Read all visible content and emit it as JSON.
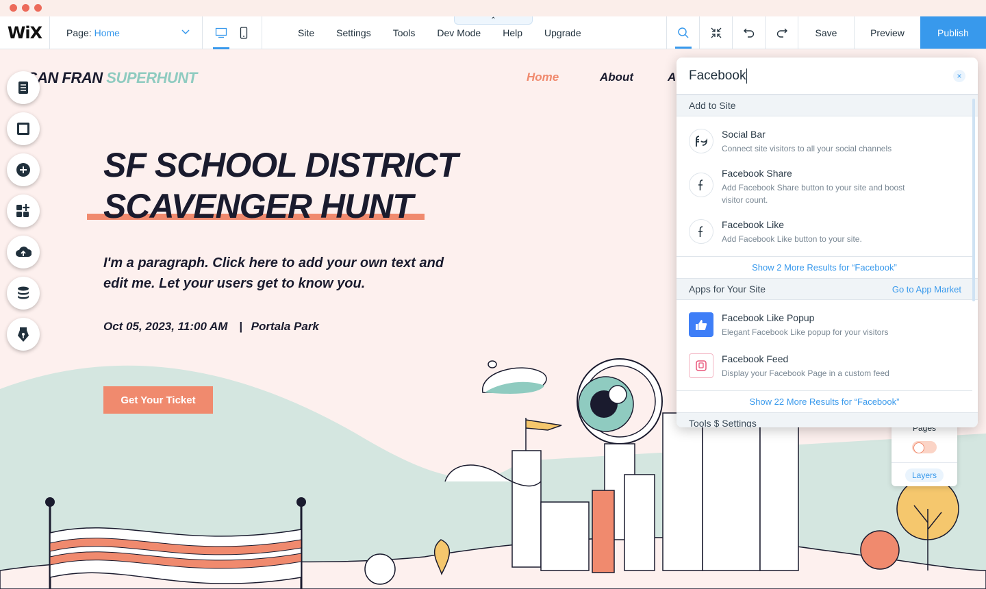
{
  "topbar": {
    "logo": "WiX",
    "page_label": "Page:",
    "page_value": "Home",
    "menu": [
      "Site",
      "Settings",
      "Tools",
      "Dev Mode",
      "Help",
      "Upgrade"
    ],
    "save": "Save",
    "preview": "Preview",
    "publish": "Publish",
    "collapse_glyph": "⌃"
  },
  "site": {
    "logo_part1": "SAN FRAN ",
    "logo_part2": "SUPERHUNT",
    "nav": [
      "Home",
      "About",
      "A"
    ],
    "title_line1": "SF SCHOOL DISTRICT",
    "title_line2": "SCAVENGER HUNT",
    "paragraph": "I'm a paragraph. Click here to add your own text and edit me. Let your users get to know you.",
    "date": "Oct 05, 2023, 11:00 AM",
    "separator": "|",
    "venue": "Portala Park",
    "cta": "Get Your Ticket"
  },
  "left_rail": [
    "pages-icon",
    "section-icon",
    "add-icon",
    "add-apps-icon",
    "upload-icon",
    "database-icon",
    "pen-icon"
  ],
  "mini_panel": {
    "pages": "Pages",
    "layers": "Layers"
  },
  "search": {
    "query": "Facebook",
    "clear_glyph": "×",
    "section_add": "Add to Site",
    "add_results": [
      {
        "title": "Social Bar",
        "desc": "Connect site visitors to all your social channels",
        "icon": "social-bar-icon"
      },
      {
        "title": "Facebook Share",
        "desc": "Add Facebook Share button to your site and boost visitor count.",
        "icon": "facebook-icon"
      },
      {
        "title": "Facebook Like",
        "desc": "Add Facebook Like button to your site.",
        "icon": "facebook-icon"
      }
    ],
    "show_more_add": "Show 2 More Results for “Facebook”",
    "section_apps": "Apps for Your Site",
    "app_market_link": "Go to App Market",
    "app_results": [
      {
        "title": "Facebook Like Popup",
        "desc": "Elegant Facebook Like popup for your visitors",
        "icon": "thumbs-up-icon"
      },
      {
        "title": "Facebook Feed",
        "desc": "Display your Facebook Page in a custom feed",
        "icon": "feed-icon"
      }
    ],
    "show_more_apps": "Show 22 More Results for “Facebook”",
    "section_tools": "Tools $ Settings"
  },
  "colors": {
    "accent": "#3899ec",
    "coral": "#f08a6e",
    "teal": "#8fcbc0",
    "background": "#fdf0ee",
    "ink": "#1a1b2e"
  }
}
